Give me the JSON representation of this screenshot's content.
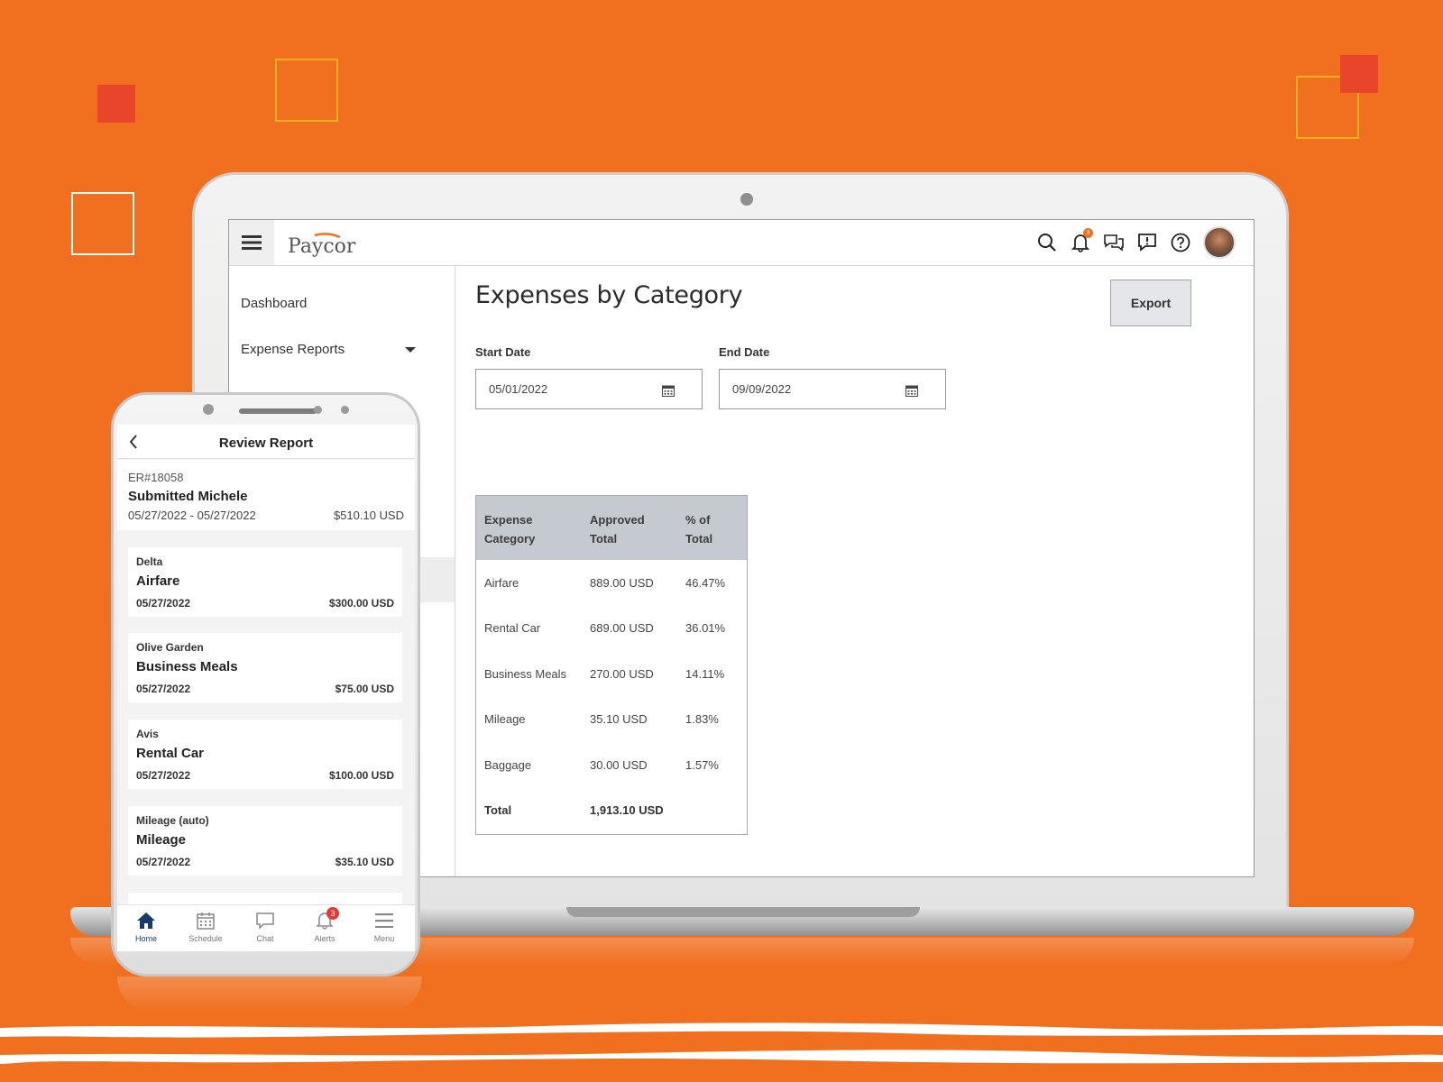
{
  "colors": {
    "background": "#F07020",
    "accent_red": "#E8452A",
    "accent_yellow": "#F7B21C",
    "logo_orange": "#F07020",
    "nav_active": "#1A3A6B",
    "table_header": "#C5C9D0"
  },
  "desktop": {
    "logo_text": "Paycor",
    "top_icons": [
      "search-icon",
      "bell-icon",
      "chat-icon",
      "feedback-icon",
      "help-icon",
      "avatar"
    ],
    "notification_badge": "3",
    "sidebar": {
      "items": [
        {
          "label": "Dashboard"
        },
        {
          "label": "Expense Reports",
          "expandable": true
        }
      ]
    },
    "page_title": "Expenses by Category",
    "export_label": "Export",
    "start_date": {
      "label": "Start Date",
      "value": "05/01/2022"
    },
    "end_date": {
      "label": "End Date",
      "value": "09/09/2022"
    },
    "table": {
      "headers": [
        [
          "Expense",
          "Category"
        ],
        [
          "Approved",
          "Total"
        ],
        [
          "% of",
          "Total"
        ]
      ],
      "rows": [
        {
          "category": "Airfare",
          "total": "889.00 USD",
          "percent": "46.47%"
        },
        {
          "category": "Rental Car",
          "total": "689.00 USD",
          "percent": "36.01%"
        },
        {
          "category": "Business Meals",
          "total": "270.00 USD",
          "percent": "14.11%"
        },
        {
          "category": "Mileage",
          "total": "35.10 USD",
          "percent": "1.83%"
        },
        {
          "category": "Baggage",
          "total": "30.00 USD",
          "percent": "1.57%"
        }
      ],
      "total_row": {
        "label": "Total",
        "total": "1,913.10 USD"
      }
    }
  },
  "mobile": {
    "title": "Review Report",
    "report_id": "ER#18058",
    "submitter": "Submitted Michele",
    "date_range": "05/27/2022 - 05/27/2022",
    "report_amount": "$510.10 USD",
    "expenses": [
      {
        "vendor": "Delta",
        "category": "Airfare",
        "date": "05/27/2022",
        "amount": "$300.00  USD"
      },
      {
        "vendor": "Olive Garden",
        "category": "Business Meals",
        "date": "05/27/2022",
        "amount": "$75.00  USD"
      },
      {
        "vendor": "Avis",
        "category": "Rental Car",
        "date": "05/27/2022",
        "amount": "$100.00  USD"
      },
      {
        "vendor": "Mileage (auto)",
        "category": "Mileage",
        "date": "05/27/2022",
        "amount": "$35.10  USD"
      }
    ],
    "nav": [
      {
        "label": "Home",
        "icon": "home-icon",
        "active": true
      },
      {
        "label": "Schedule",
        "icon": "calendar-icon"
      },
      {
        "label": "Chat",
        "icon": "chat-icon"
      },
      {
        "label": "Alerts",
        "icon": "bell-icon",
        "badge": "3"
      },
      {
        "label": "Menu",
        "icon": "menu-icon"
      }
    ]
  }
}
